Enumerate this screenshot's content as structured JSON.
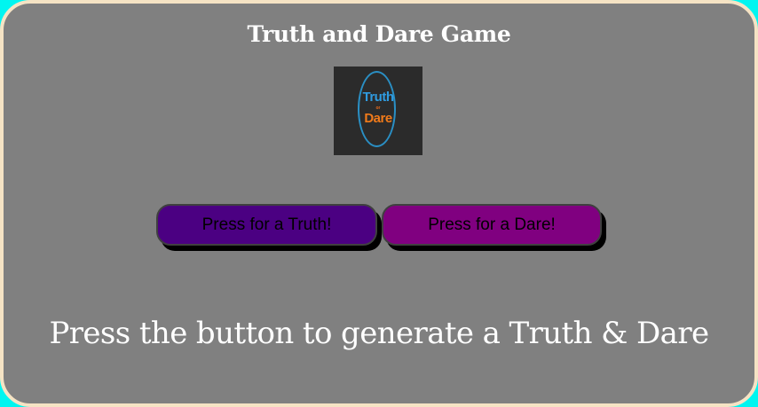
{
  "game": {
    "title": "Truth and Dare Game",
    "logo": {
      "word_top": "Truth",
      "word_mid": "or",
      "word_bottom": "Dare"
    },
    "buttons": {
      "truth_label": "Press for a Truth!",
      "dare_label": "Press for a Dare!"
    },
    "prompt_text": "Press the button to generate a Truth & Dare"
  },
  "colors": {
    "page_background": "#00f5f0",
    "card_background": "#808080",
    "card_border": "#f5e3c4",
    "truth_button": "#4b0082",
    "dare_button": "#800080",
    "logo_blue": "#2f9be0",
    "logo_orange": "#f07a1a"
  }
}
